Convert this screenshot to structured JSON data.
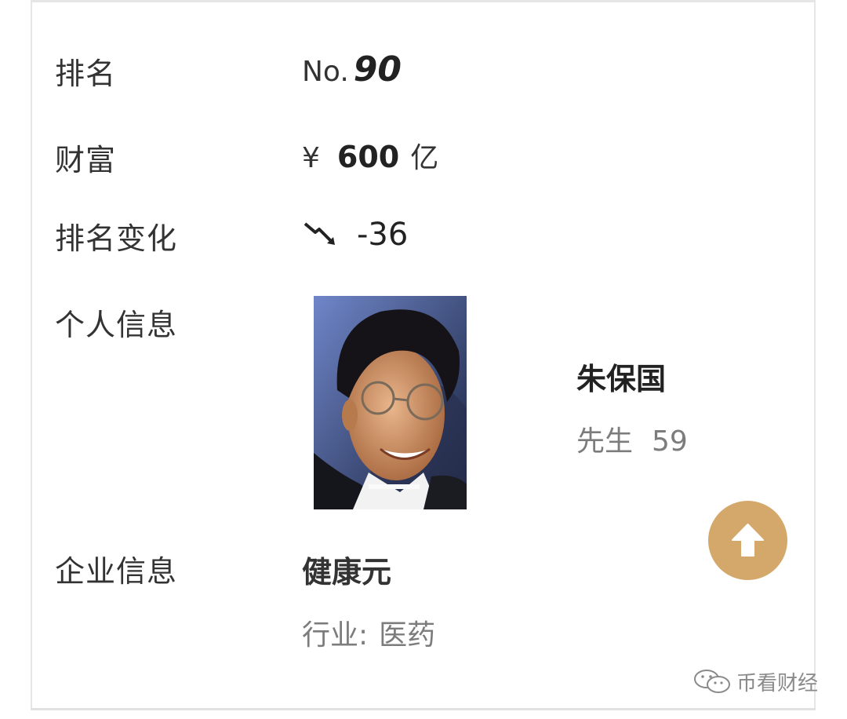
{
  "rows": {
    "rank": {
      "label": "排名",
      "prefix": "No.",
      "value": "90"
    },
    "wealth": {
      "label": "财富",
      "currency": "¥",
      "value": "600",
      "unit": "亿"
    },
    "rank_change": {
      "label": "排名变化",
      "trend_icon": "trend-down-icon",
      "value": "-36"
    },
    "personal_info": {
      "label": "个人信息",
      "name": "朱保国",
      "title": "先生",
      "age": "59"
    },
    "company_info": {
      "label": "企业信息",
      "company": "健康元",
      "industry_label": "行业:",
      "industry": "医药"
    }
  },
  "back_to_top": {
    "icon": "arrow-up-icon",
    "color": "#d4a86a"
  },
  "watermark": {
    "icon": "wechat-icon",
    "text": "币看财经"
  },
  "colors": {
    "label": "#333333",
    "muted": "#7c7c7c",
    "accent": "#d4a86a",
    "border": "#e6e6e6"
  }
}
